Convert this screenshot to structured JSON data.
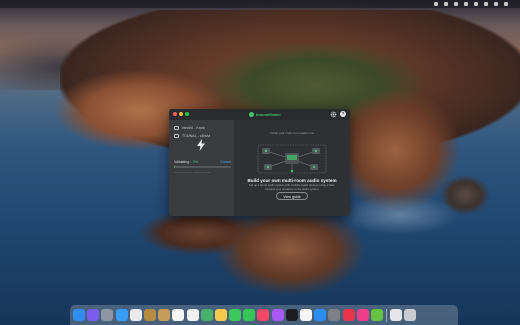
{
  "desktop": {
    "menubar": {
      "right_items": [
        "",
        "",
        "",
        "",
        "",
        "",
        "",
        "",
        ""
      ],
      "clock": ""
    }
  },
  "app_window": {
    "brand": "boomeflower",
    "devices": [
      {
        "label": "electrX - Knob"
      },
      {
        "label": "TOUNA1 - c4bvta"
      }
    ],
    "validating": {
      "label": "Validating...",
      "percent": "2%",
      "cancel_label": "Cancel",
      "progress": 0.02,
      "subtext": "—————— ——————"
    },
    "intro_text": "Install your multi-room audio now",
    "headline": "Build your own multi-room audio system",
    "description": "Set up a home audio system with multiple Apple devices using a Mac. Connect your speakers to the audio system.",
    "view_guide_label": "View guide",
    "colors": {
      "accent": "#3ec46d",
      "link": "#4f9ee8"
    }
  },
  "dock": {
    "apps": [
      {
        "name": "finder-icon",
        "color": "#2f8cf0"
      },
      {
        "name": "siri-icon",
        "color": "#7a5cf0"
      },
      {
        "name": "launchpad-icon",
        "color": "#8d96a3"
      },
      {
        "name": "safari-icon",
        "color": "#3a9df5"
      },
      {
        "name": "photos-app-icon",
        "color": "#e9e9ee"
      },
      {
        "name": "notes-icon",
        "color": "#b58b42"
      },
      {
        "name": "contacts-icon",
        "color": "#c79c5a"
      },
      {
        "name": "calendar-icon",
        "color": "#f4f4f4"
      },
      {
        "name": "reminders-icon",
        "color": "#f0f0f0"
      },
      {
        "name": "maps-icon",
        "color": "#49b16a"
      },
      {
        "name": "photos-icon",
        "color": "#f3c94b"
      },
      {
        "name": "messages-icon",
        "color": "#3cc95b"
      },
      {
        "name": "facetime-icon",
        "color": "#35c556"
      },
      {
        "name": "music-icon",
        "color": "#f04866"
      },
      {
        "name": "podcasts-icon",
        "color": "#a65af0"
      },
      {
        "name": "tv-icon",
        "color": "#1d1d1f"
      },
      {
        "name": "news-icon",
        "color": "#f4f4f4"
      },
      {
        "name": "appstore-icon",
        "color": "#2c8ef5"
      },
      {
        "name": "system-preferences-icon",
        "color": "#7d8087"
      },
      {
        "name": "app-red-icon",
        "color": "#e8354b"
      },
      {
        "name": "app-pink-icon",
        "color": "#ee3d8b"
      },
      {
        "name": "app-green-cube-icon",
        "color": "#66c33f"
      },
      {
        "name": "files-icon",
        "color": "#e6e6ea"
      },
      {
        "name": "trash-icon",
        "color": "#c9ccd2"
      }
    ]
  }
}
